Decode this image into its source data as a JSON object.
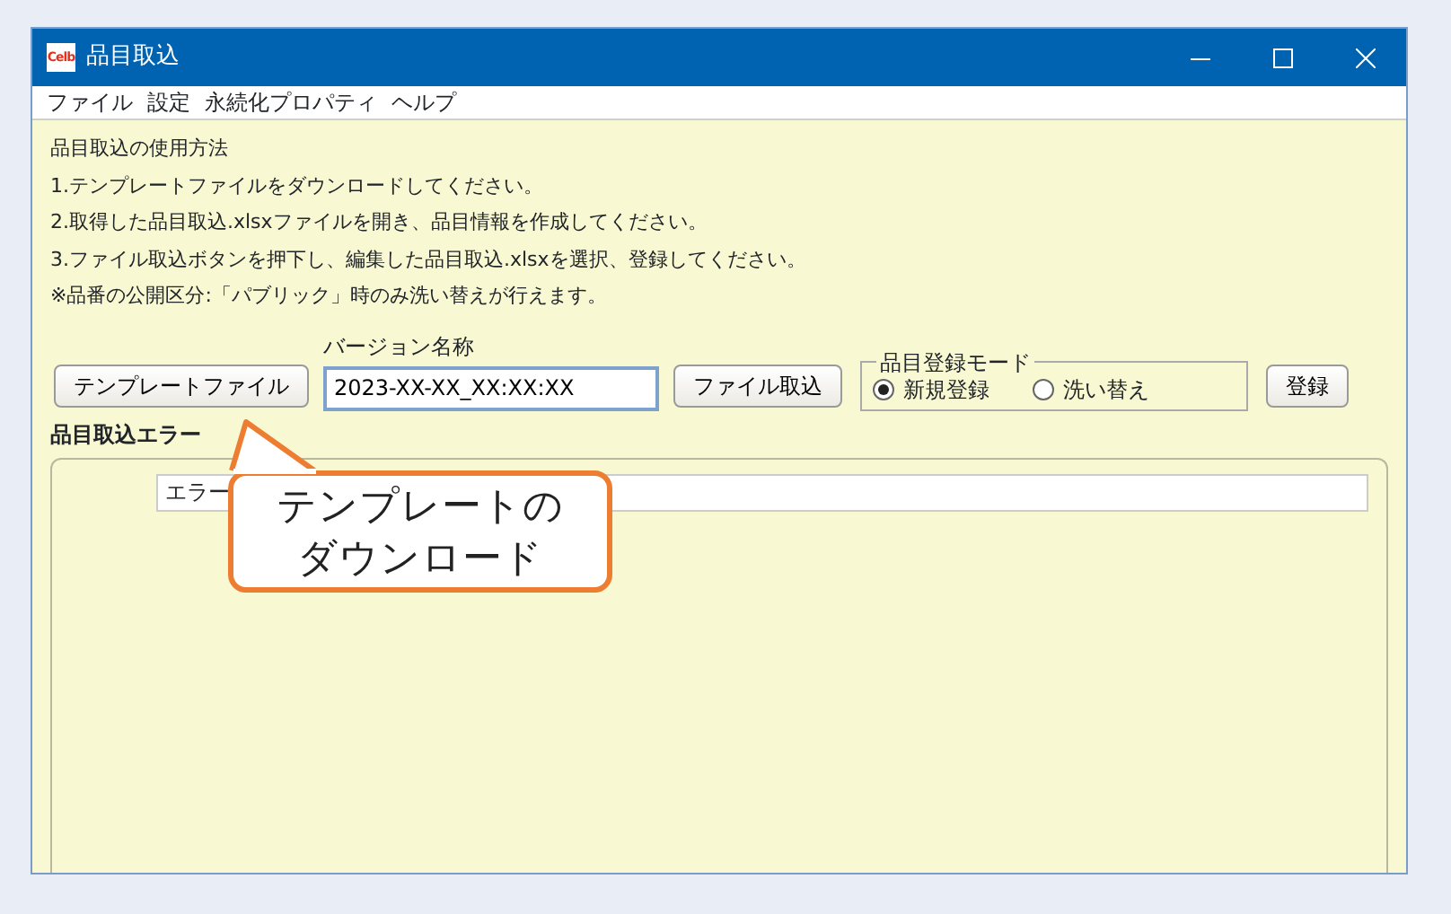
{
  "window": {
    "title": "品目取込",
    "app_icon_text": "Celb"
  },
  "menu": [
    "ファイル",
    "設定",
    "永続化プロパティ",
    "ヘルプ"
  ],
  "instructions": [
    "品目取込の使用方法",
    "1.テンプレートファイルをダウンロードしてください。",
    "2.取得した品目取込.xlsxファイルを開き、品目情報を作成してください。",
    "3.ファイル取込ボタンを押下し、編集した品目取込.xlsxを選択、登録してください。",
    "※品番の公開区分:「パブリック」時のみ洗い替えが行えます。"
  ],
  "template_button": "テンプレートファイル",
  "version": {
    "label": "バージョン名称",
    "value": "2023-XX-XX_XX:XX:XX"
  },
  "import_button": "ファイル取込",
  "mode": {
    "legend": "品目登録モード",
    "options": [
      {
        "label": "新規登録",
        "selected": true
      },
      {
        "label": "洗い替え",
        "selected": false
      }
    ]
  },
  "register_button": "登録",
  "errors": {
    "title": "品目取込エラー",
    "columns": [
      "エラー"
    ]
  },
  "callout": {
    "lines": [
      "テンプレートの",
      "ダウンロード"
    ]
  }
}
